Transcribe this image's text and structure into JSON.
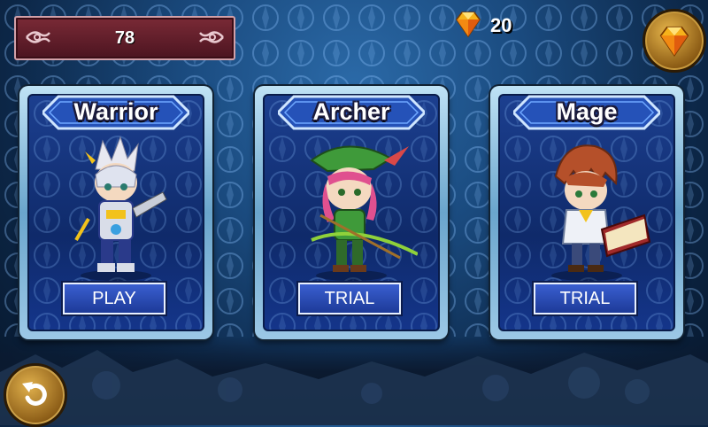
{
  "counter": {
    "value": "78"
  },
  "currency": {
    "gems": "20",
    "gem_icon": "gem-icon",
    "shop_icon": "gem-shop-icon"
  },
  "cards": [
    {
      "title": "Warrior",
      "button": "PLAY",
      "hero_icon": "warrior-hero-icon"
    },
    {
      "title": "Archer",
      "button": "TRIAL",
      "hero_icon": "archer-hero-icon"
    },
    {
      "title": "Mage",
      "button": "TRIAL",
      "hero_icon": "mage-hero-icon"
    }
  ],
  "back_button": {
    "icon": "back-arrow-icon"
  },
  "colors": {
    "accent_gold": "#e7b64b",
    "counter_bg": "#7a2a36",
    "card_frame": "#6aa5cc",
    "button_blue": "#2a4fbf"
  }
}
